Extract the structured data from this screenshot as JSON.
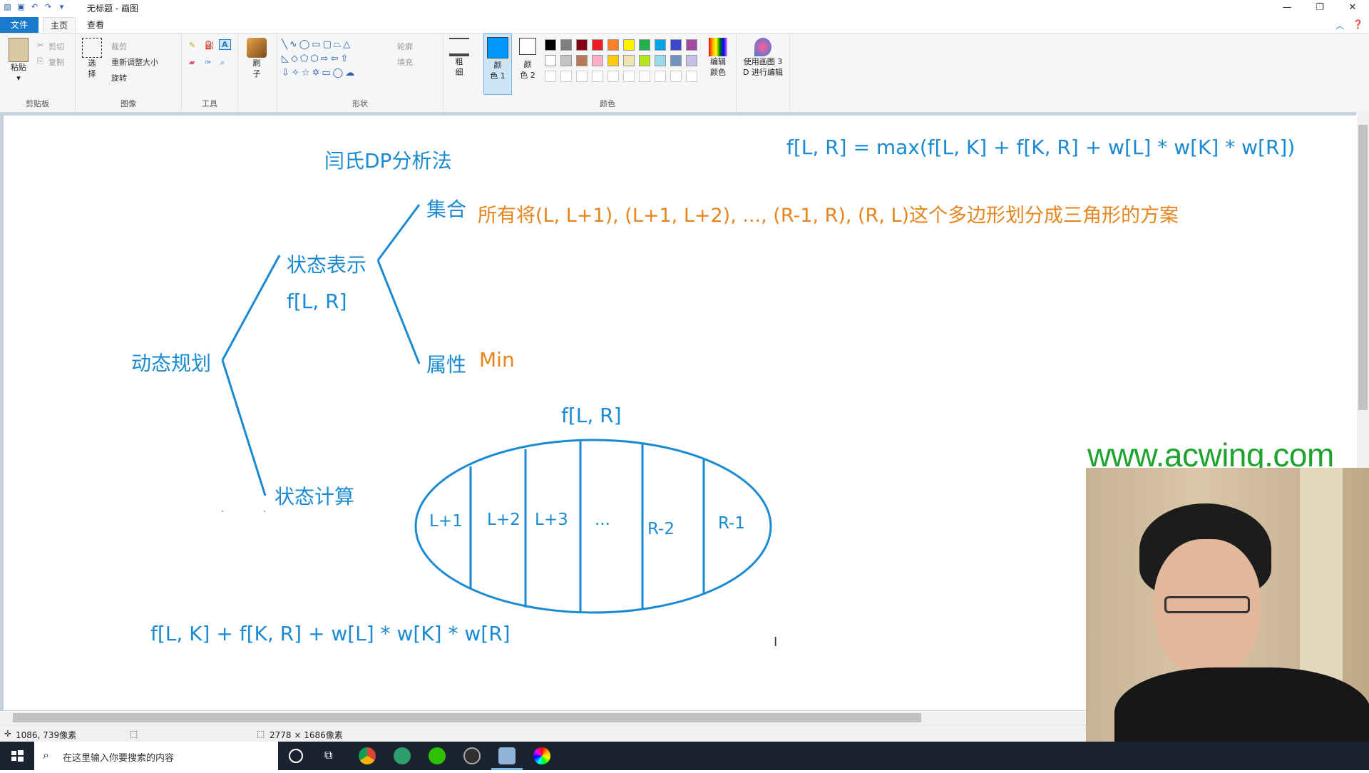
{
  "window": {
    "title": "无标题 - 画图",
    "controls": [
      "—",
      "❐",
      "✕"
    ]
  },
  "tabs": {
    "file": "文件",
    "home": "主页",
    "view": "查看"
  },
  "ribbon": {
    "clipboard": {
      "paste": "粘贴",
      "cut": "剪切",
      "copy": "复制",
      "label": "剪贴板"
    },
    "image": {
      "select_line1": "选",
      "select_line2": "择",
      "crop": "裁剪",
      "resize": "重新调整大小",
      "rotate": "旋转",
      "label": "图像"
    },
    "tools": {
      "label": "工具"
    },
    "brushes": {
      "line1": "刷",
      "line2": "子"
    },
    "shapes": {
      "outline": "轮廓",
      "fill": "填充",
      "label": "形状"
    },
    "size": {
      "line1": "粗",
      "line2": "细"
    },
    "colors": {
      "color1_line1": "颜",
      "color1_line2": "色 1",
      "color2_line1": "颜",
      "color2_line2": "色 2",
      "edit_line1": "编辑",
      "edit_line2": "颜色",
      "label": "颜色",
      "palette_row1": [
        "#000000",
        "#7f7f7f",
        "#880015",
        "#ed1c24",
        "#ff7f27",
        "#fff200",
        "#22b14c",
        "#00a2e8",
        "#3f48cc",
        "#a349a4"
      ],
      "palette_row2": [
        "#ffffff",
        "#c3c3c3",
        "#b97a57",
        "#ffaec9",
        "#ffc90e",
        "#efe4b0",
        "#b5e61d",
        "#99d9ea",
        "#7092be",
        "#c8bfe7"
      ],
      "color1_value": "#0096ff",
      "color2_value": "#ffffff"
    },
    "paint3d": {
      "line1": "使用画图 3",
      "line2": "D 进行编辑"
    }
  },
  "drawing": {
    "method_title": "闫氏DP分析法",
    "formula": "f[L, R]  =  max(f[L, K]  +  f[K, R]  +  w[L]  *  w[K]  *  w[R])",
    "root": "动态规划",
    "state_repr": "状态表示",
    "state_func": "f[L, R]",
    "set_label": "集合",
    "set_desc": "所有将(L, L+1), (L+1, L+2), ..., (R-1, R), (R, L)这个多边形划分成三角形的方案",
    "attr_label": "属性",
    "attr_value": "Min",
    "state_calc": "状态计算",
    "ellipse_title": "f[L, R]",
    "partitions": [
      "L+1",
      "L+2",
      "L+3",
      "...",
      "R-2",
      "R-1"
    ],
    "bottom_formula": "f[L, K]  +  f[K, R]  +  w[L]  *  w[K]  *  w[R]"
  },
  "webcam": {
    "watermark": "www.acwing.com"
  },
  "status": {
    "cursor_pos": "1086, 739像素",
    "image_size": "2778 × 1686像素"
  },
  "taskbar": {
    "search_placeholder": "在这里输入你要搜索的内容"
  }
}
